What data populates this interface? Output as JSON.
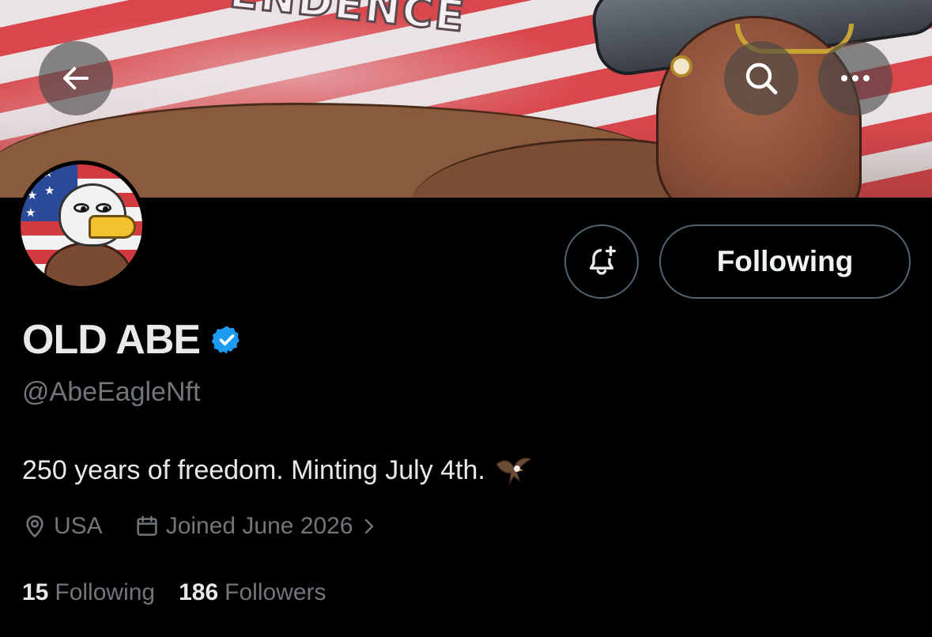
{
  "header": {
    "back_icon": "arrow-left-icon",
    "search_icon": "search-icon",
    "more_icon": "more-horizontal-icon"
  },
  "banner": {
    "banner_text": "ENDENCE"
  },
  "actions": {
    "notify_icon": "bell-plus-icon",
    "following_label": "Following"
  },
  "profile": {
    "display_name": "OLD ABE",
    "verified_icon": "verified-badge-icon",
    "handle": "@AbeEagleNft",
    "bio": "250 years of freedom. Minting July 4th.",
    "bio_emoji_icon": "eagle-emoji-icon",
    "location_icon": "location-pin-icon",
    "location": "USA",
    "joined_icon": "calendar-icon",
    "joined": "Joined June 2026",
    "joined_chevron_icon": "chevron-right-icon"
  },
  "stats": {
    "following_count": "15",
    "following_label": "Following",
    "followers_count": "186",
    "followers_label": "Followers"
  },
  "colors": {
    "background": "#000000",
    "primary_text": "#e7e9ea",
    "secondary_text": "#71767b",
    "border": "#536471",
    "verified_blue": "#1d9bf0"
  }
}
